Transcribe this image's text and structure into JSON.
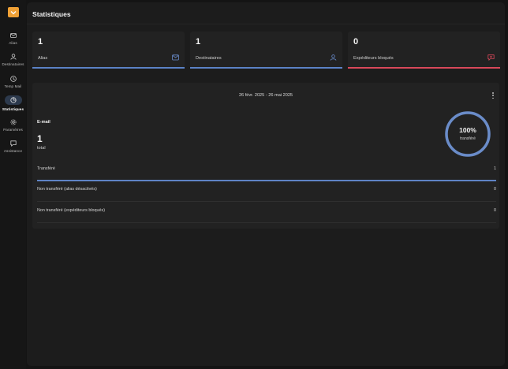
{
  "sidebar": {
    "items": [
      {
        "label": "Alias",
        "icon": "mail-icon"
      },
      {
        "label": "Destinataires",
        "icon": "user-icon"
      },
      {
        "label": "Temp Mail",
        "icon": "clock-icon"
      },
      {
        "label": "Statistiques",
        "icon": "pie-chart-icon",
        "active": true
      },
      {
        "label": "Paramètres",
        "icon": "gear-icon"
      },
      {
        "label": "Assistance",
        "icon": "message-icon"
      }
    ]
  },
  "page": {
    "title": "Statistiques"
  },
  "stats": [
    {
      "value": "1",
      "label": "Alias",
      "icon": "mail-icon",
      "color": "#5b82c6"
    },
    {
      "value": "1",
      "label": "Destinataires",
      "icon": "user-icon",
      "color": "#5b82c6"
    },
    {
      "value": "0",
      "label": "Expéditeurs bloqués",
      "icon": "blocked-message-icon",
      "color": "#d9485a"
    }
  ],
  "panel": {
    "date_range": "26 févr. 2025 - 26 mai 2025",
    "email_title": "E-mail",
    "email_count": "1",
    "email_total_label": "total",
    "gauge": {
      "percent": "100%",
      "label": "transféré",
      "fraction": 1.0,
      "color": "#6a8cc9"
    },
    "rows": [
      {
        "label": "Transféré",
        "value": "1",
        "active": true
      },
      {
        "label": "Non transféré (alias désactivés)",
        "value": "0"
      },
      {
        "label": "Non transféré (expéditeurs bloqués)",
        "value": "0"
      }
    ]
  },
  "colors": {
    "accent": "#5b82c6",
    "danger": "#d9485a",
    "logo": "#f0a136"
  }
}
